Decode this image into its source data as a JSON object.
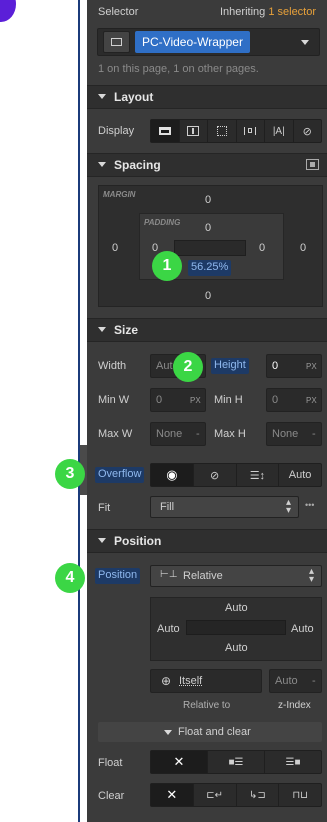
{
  "selector": {
    "label": "Selector",
    "inheriting_prefix": "Inheriting",
    "inheriting_count": "1 selector",
    "class_name": "PC-Video-Wrapper",
    "page_info": "1 on this page, 1 on other pages."
  },
  "layout": {
    "title": "Layout",
    "display_label": "Display"
  },
  "spacing": {
    "title": "Spacing",
    "margin_label": "MARGIN",
    "padding_label": "PADDING",
    "margin_top": "0",
    "margin_left": "0",
    "margin_right": "0",
    "margin_bottom": "0",
    "padding_top": "0",
    "padding_left": "0",
    "padding_right": "0",
    "padding_bottom": "56.25%"
  },
  "size": {
    "title": "Size",
    "width_label": "Width",
    "width_value": "Auto",
    "height_label": "Height",
    "height_value": "0",
    "height_unit": "PX",
    "minw_label": "Min W",
    "minw_value": "0",
    "minw_unit": "PX",
    "minh_label": "Min H",
    "minh_value": "0",
    "minh_unit": "PX",
    "maxw_label": "Max W",
    "maxw_value": "None",
    "maxw_unit": "-",
    "maxh_label": "Max H",
    "maxh_value": "None",
    "maxh_unit": "-",
    "overflow_label": "Overflow",
    "overflow_auto": "Auto",
    "fit_label": "Fit",
    "fit_value": "Fill",
    "fit_more": "•••"
  },
  "position": {
    "title": "Position",
    "position_label": "Position",
    "position_value": "Relative",
    "top": "Auto",
    "left": "Auto",
    "right": "Auto",
    "bottom": "Auto",
    "relative_value": "Itself",
    "z_value": "Auto",
    "z_unit": "-",
    "relative_to_label": "Relative to",
    "z_index_label": "z-Index",
    "float_clear_label": "Float and clear",
    "float_label": "Float",
    "clear_label": "Clear"
  },
  "annotations": [
    "1",
    "2",
    "3",
    "4"
  ],
  "colors": {
    "panel_bg": "#3b3b3b",
    "header_bg": "#2f2f2f",
    "accent_blue": "#2f6fc6",
    "badge_green": "#3bd645",
    "inherit_orange": "#e8a13a",
    "purple": "#5b1fd8"
  }
}
